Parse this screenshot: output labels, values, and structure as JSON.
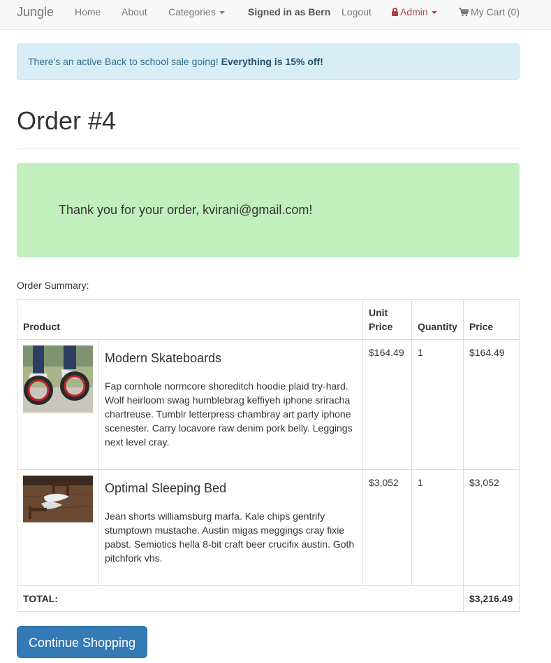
{
  "nav": {
    "brand": "Jungle",
    "home": "Home",
    "about": "About",
    "categories": "Categories",
    "signed_in": "Signed in as Bern",
    "logout": "Logout",
    "admin": "Admin",
    "cart": "My Cart (0)"
  },
  "alert": {
    "text": "There's an active Back to school sale going! ",
    "emphasis": "Everything is 15% off!"
  },
  "page_title": "Order #4",
  "thanks": "Thank you for your order, kvirani@gmail.com!",
  "summary_label": "Order Summary:",
  "table": {
    "headers": {
      "product": "Product",
      "unit_price_1": "Unit",
      "unit_price_2": "Price",
      "quantity": "Quantity",
      "price": "Price"
    },
    "rows": [
      {
        "name": "Modern Skateboards",
        "description": "Fap cornhole normcore shoreditch hoodie plaid try-hard. Wolf heirloom swag humblebrag keffiyeh iphone sriracha chartreuse. Tumblr letterpress chambray art party iphone scenester. Carry locavore raw denim pork belly. Leggings next level cray.",
        "unit_price": "$164.49",
        "quantity": "1",
        "price": "$164.49"
      },
      {
        "name": "Optimal Sleeping Bed",
        "description": "Jean shorts williamsburg marfa. Kale chips gentrify stumptown mustache. Austin migas meggings cray fixie pabst. Semiotics hella 8-bit craft beer crucifix austin. Goth pitchfork vhs.",
        "unit_price": "$3,052",
        "quantity": "1",
        "price": "$3,052"
      }
    ],
    "total_label": "TOTAL:",
    "total_value": "$3,216.49"
  },
  "continue_button": "Continue Shopping",
  "colors": {
    "navbar_bg": "#f8f8f8",
    "alert_bg": "#d9edf7",
    "alert_text": "#31708f",
    "thanks_bg": "#c1efbd",
    "admin": "#a94442",
    "primary": "#337ab7"
  },
  "icons": {
    "admin": "lock-icon",
    "cart": "shopping-cart-icon",
    "dropdown": "caret-down-icon"
  }
}
